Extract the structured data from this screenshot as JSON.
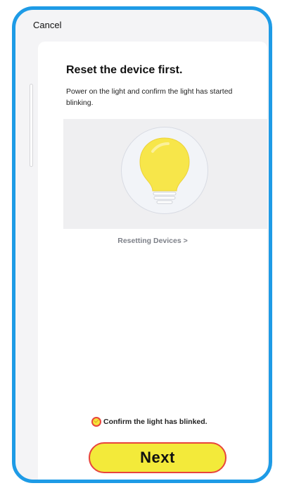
{
  "header": {
    "cancel_label": "Cancel"
  },
  "main": {
    "title": "Reset the device first.",
    "description": "Power on the light and confirm the light has started blinking.",
    "illustration_icon": "lightbulb-icon",
    "resetting_link_label": "Resetting Devices >",
    "confirm_label": "Confirm the light has blinked.",
    "confirm_checked": true,
    "next_button_label": "Next"
  },
  "colors": {
    "frame_accent": "#1e9be6",
    "highlight_fill": "#f3ea3a",
    "highlight_border": "#e8453c",
    "bulb_yellow": "#f7e64a",
    "link_gray": "#7d8088"
  }
}
